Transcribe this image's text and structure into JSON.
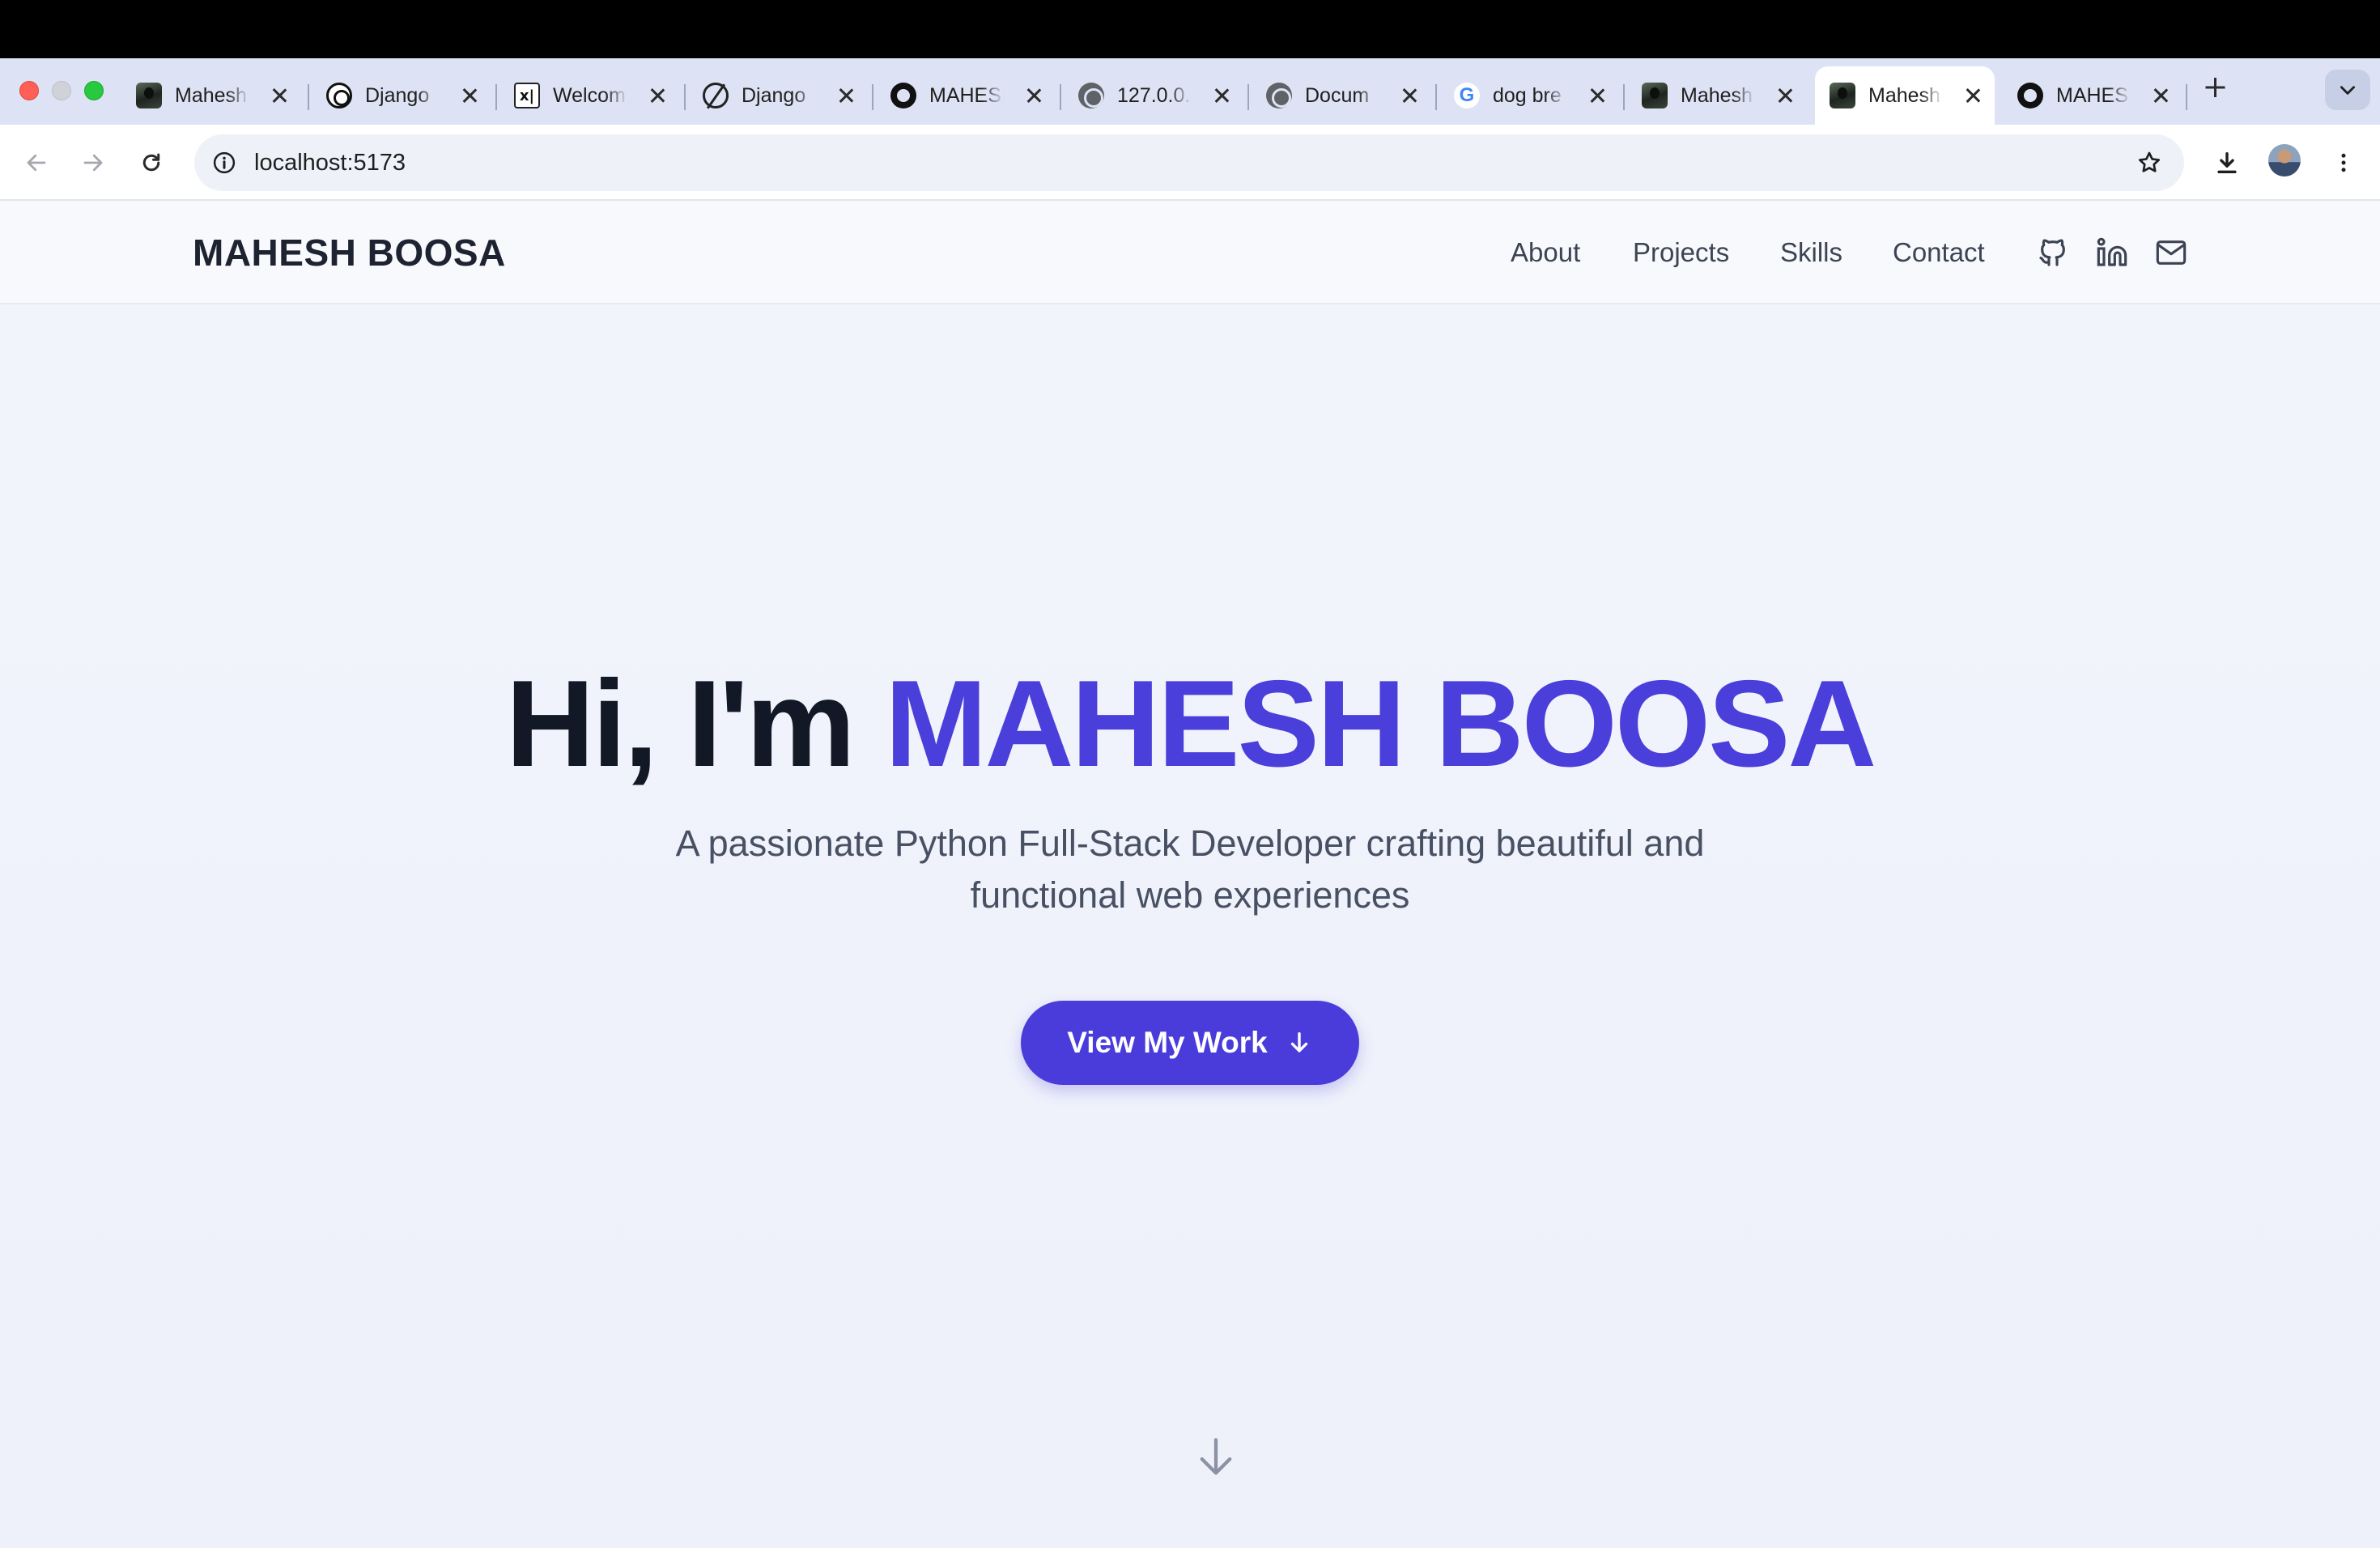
{
  "browser": {
    "tabs": [
      {
        "title": "Mahesh",
        "favicon": "photo"
      },
      {
        "title": "Django",
        "favicon": "openai"
      },
      {
        "title": "Welcom",
        "favicon": "xl"
      },
      {
        "title": "Django",
        "favicon": "django"
      },
      {
        "title": "MAHESI",
        "favicon": "github"
      },
      {
        "title": "127.0.0.",
        "favicon": "globe"
      },
      {
        "title": "Docum",
        "favicon": "globe"
      },
      {
        "title": "dog bre",
        "favicon": "google"
      },
      {
        "title": "Mahesh",
        "favicon": "photo"
      },
      {
        "title": "Mahesh",
        "favicon": "photo",
        "active": true
      },
      {
        "title": "MAHESI",
        "favicon": "github"
      }
    ],
    "favicon_letters": {
      "xl": "x|",
      "google": "G"
    },
    "url": "localhost:5173"
  },
  "site": {
    "brand": "MAHESH BOOSA",
    "nav": {
      "about": "About",
      "projects": "Projects",
      "skills": "Skills",
      "contact": "Contact"
    },
    "social_icons": [
      "github-icon",
      "linkedin-icon",
      "mail-icon"
    ],
    "hero": {
      "greeting": "Hi, I'm ",
      "name": "MAHESH BOOSA",
      "subtitle_line1": "A passionate Python Full-Stack Developer crafting beautiful and",
      "subtitle_line2": "functional web experiences",
      "cta_label": "View My Work"
    },
    "colors": {
      "accent": "#4b3fdb",
      "text_dark": "#121826",
      "subtitle": "#485063"
    }
  }
}
